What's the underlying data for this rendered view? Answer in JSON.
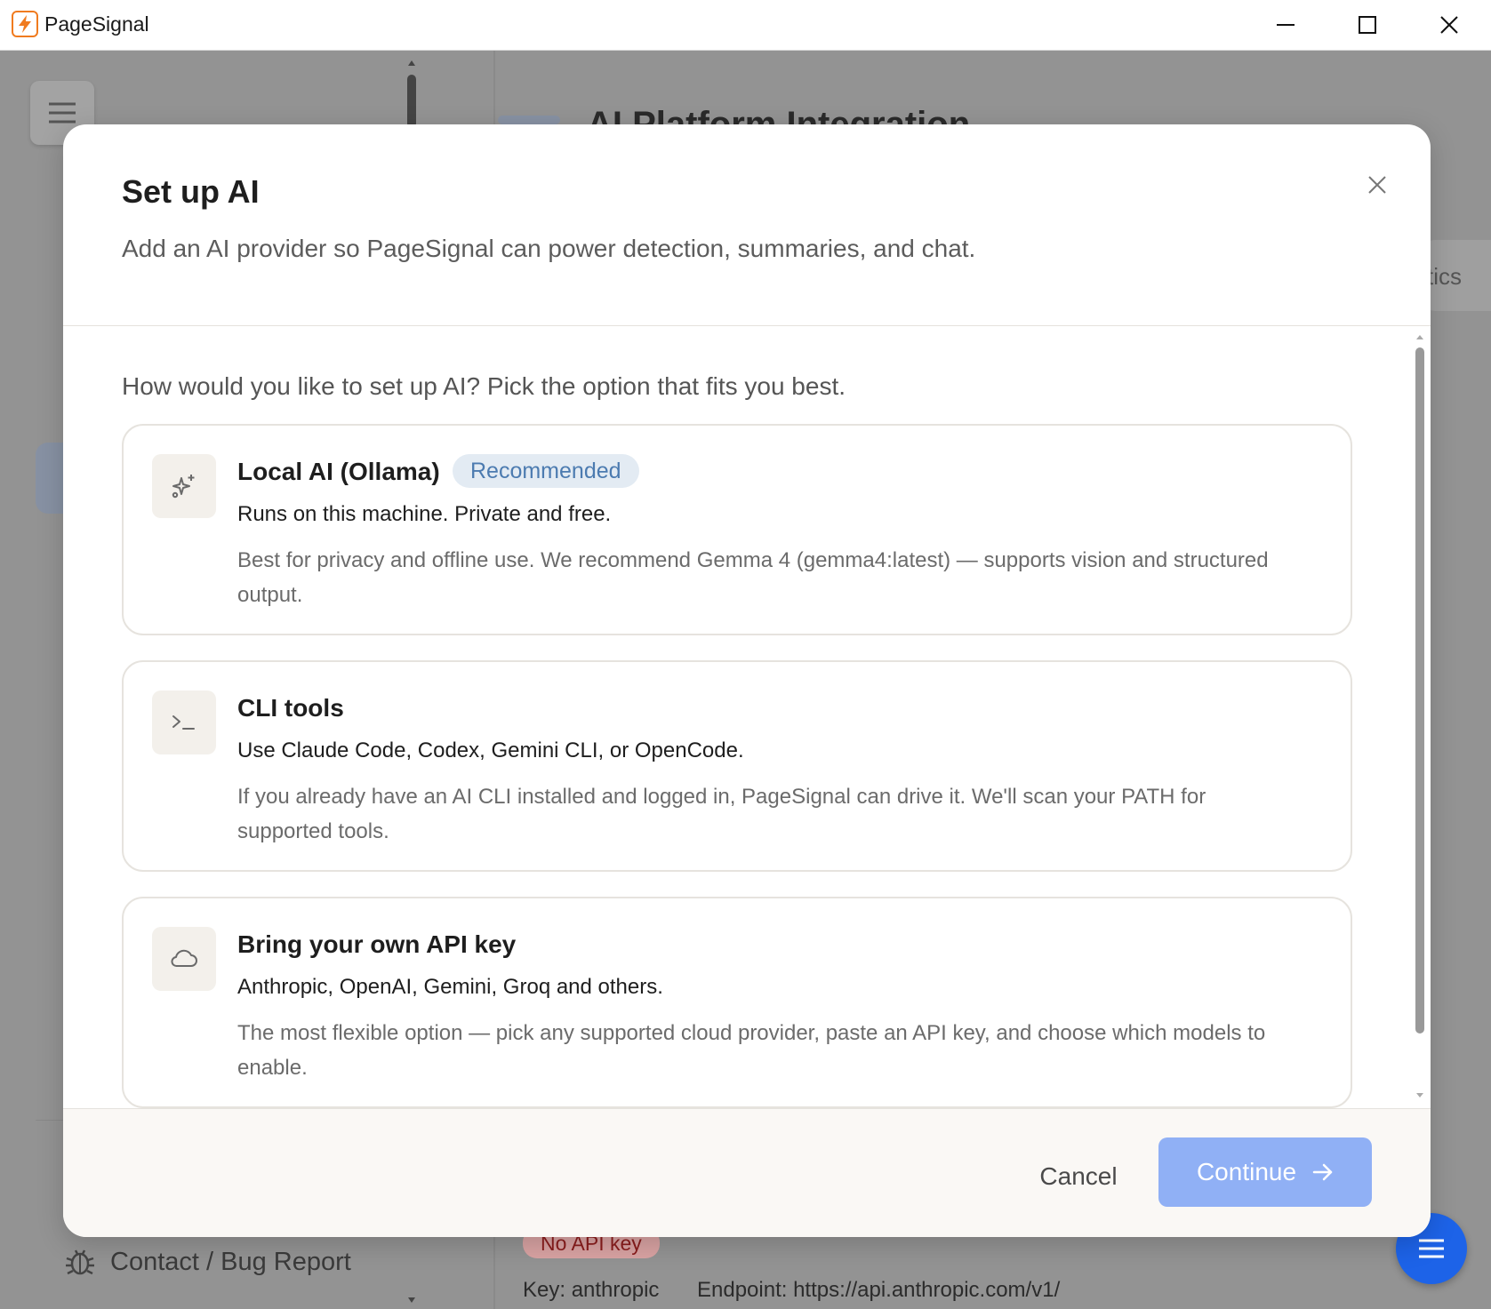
{
  "window": {
    "title": "PageSignal"
  },
  "background": {
    "header_title": "AI Platform Integration",
    "tab_partial": "tics",
    "contact_label": "Contact / Bug Report",
    "badge": "No API key",
    "key_label": "Key: anthropic",
    "endpoint_label": "Endpoint: https://api.anthropic.com/v1/"
  },
  "modal": {
    "title": "Set up AI",
    "subtitle": "Add an AI provider so PageSignal can power detection, summaries, and chat.",
    "prompt": "How would you like to set up AI? Pick the option that fits you best.",
    "options": [
      {
        "icon": "sparkles-icon",
        "title": "Local AI (Ollama)",
        "badge": "Recommended",
        "subtitle": "Runs on this machine. Private and free.",
        "description": "Best for privacy and offline use. We recommend Gemma 4 (gemma4:latest) — supports vision and structured output."
      },
      {
        "icon": "terminal-icon",
        "title": "CLI tools",
        "subtitle": "Use Claude Code, Codex, Gemini CLI, or OpenCode.",
        "description": "If you already have an AI CLI installed and logged in, PageSignal can drive it. We'll scan your PATH for supported tools."
      },
      {
        "icon": "cloud-icon",
        "title": "Bring your own API key",
        "subtitle": "Anthropic, OpenAI, Gemini, Groq and others.",
        "description": "The most flexible option — pick any supported cloud provider, paste an API key, and choose which models to enable."
      }
    ],
    "cancel_label": "Cancel",
    "continue_label": "Continue"
  },
  "colors": {
    "accent": "#90b0f5",
    "fab": "#1d63e8",
    "badge_bg": "#e3ebf3",
    "badge_text": "#4c7bb0",
    "logo": "#f07b1f"
  }
}
